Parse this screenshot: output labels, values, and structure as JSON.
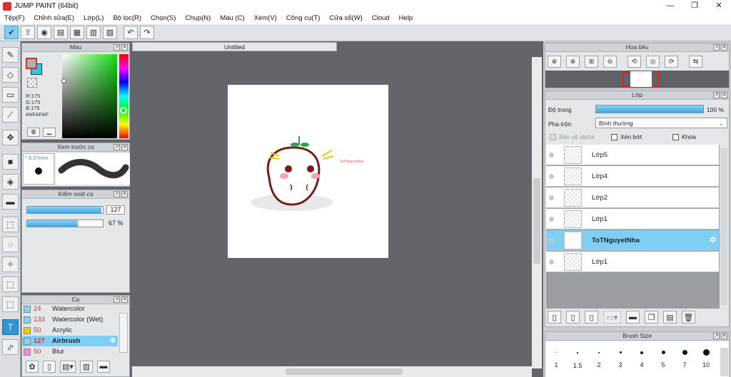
{
  "window": {
    "title": "JUMP PAINT (64bit)",
    "controls": [
      "—",
      "❐",
      "✕"
    ]
  },
  "menu": [
    "Tệp(F)",
    "Chỉnh sửa(E)",
    "Lớp(L)",
    "Bộ lọc(R)",
    "Chọn(S)",
    "Chụp(N)",
    "Màu (C)",
    "Xem(V)",
    "Công cụ(T)",
    "Cửa sổ(W)",
    "Cloud",
    "Help"
  ],
  "color_panel": {
    "title": "Màu",
    "r": "R:175",
    "g": "G:175",
    "b": "B:175",
    "hex": "#AFAFAF",
    "main_color": "#afafaf",
    "sub_color": "#29c6ee"
  },
  "brush_preview": {
    "title": "Xem trước cọ",
    "size": "5.27mm"
  },
  "brush_control": {
    "title": "Kiểm soát cọ",
    "size_value": "127",
    "opacity_value": "67 %",
    "size_fraction": 0.98,
    "opacity_fraction": 0.67
  },
  "brush_panel": {
    "title": "Cọ",
    "items": [
      {
        "size": "24",
        "name": "Watercolor",
        "color": "#7fd6f3"
      },
      {
        "size": "133",
        "name": "Watercolor (Wet)",
        "color": "#7fd6f3"
      },
      {
        "size": "50",
        "name": "Acrylic",
        "color": "#f0c800"
      },
      {
        "size": "127",
        "name": "Airbrush",
        "color": "#7fd6f3",
        "selected": true
      },
      {
        "size": "50",
        "name": "Blur",
        "color": "#f78ad9"
      }
    ]
  },
  "canvas": {
    "tab": "Untitled",
    "signature_text": "ToTNguyetNha"
  },
  "navigator": {
    "title": "Hoa tiêu"
  },
  "layers": {
    "title": "Lớp",
    "opacity_label": "Độ trong",
    "opacity_value": "100 %",
    "opacity_fraction": 1.0,
    "blend_label": "Pha trộn",
    "blend_value": "Bình thường",
    "protect_alpha": "Bảo vệ alpha",
    "clip": "Xén bớt",
    "lock": "Khóa",
    "items": [
      {
        "name": "Lớp5",
        "selected": false
      },
      {
        "name": "Lớp4",
        "selected": false
      },
      {
        "name": "Lớp2",
        "selected": false
      },
      {
        "name": "Lớp1",
        "selected": false
      },
      {
        "name": "ToTNguyetNha",
        "selected": true
      },
      {
        "name": "Lớp1",
        "selected": false
      }
    ]
  },
  "brush_size": {
    "title": "Brush Size",
    "sizes": [
      "1",
      "1.5",
      "2",
      "3",
      "4",
      "5",
      "7",
      "10"
    ]
  },
  "colors": {
    "accent": "#2d96d6",
    "selection": "#7ecff5"
  }
}
